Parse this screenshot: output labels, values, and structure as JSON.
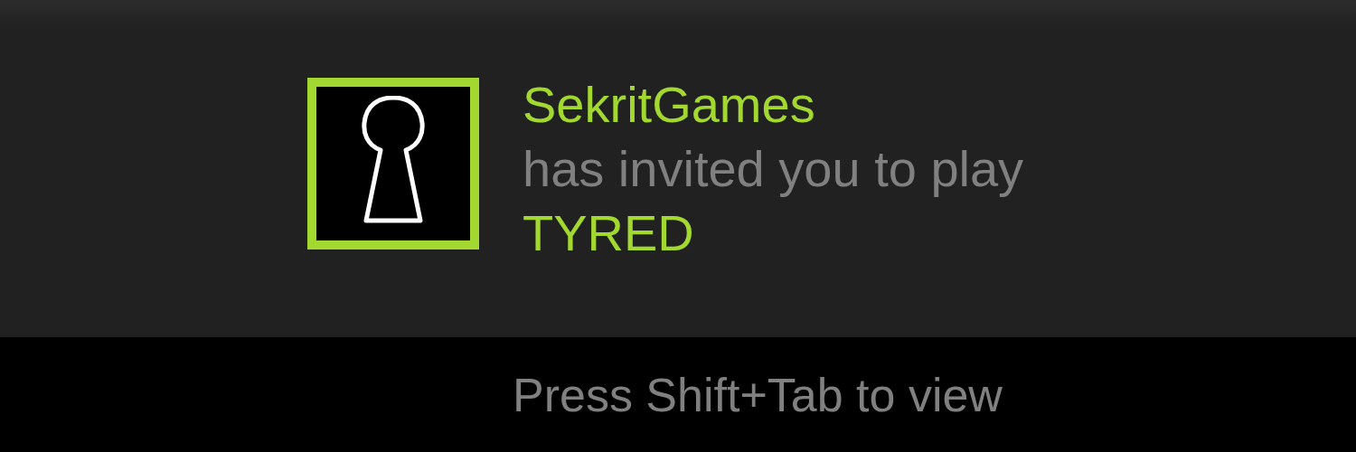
{
  "notification": {
    "sender": "SekritGames",
    "message": "has invited you to play",
    "game": "TYRED"
  },
  "footer": {
    "hint": "Press Shift+Tab to view"
  }
}
